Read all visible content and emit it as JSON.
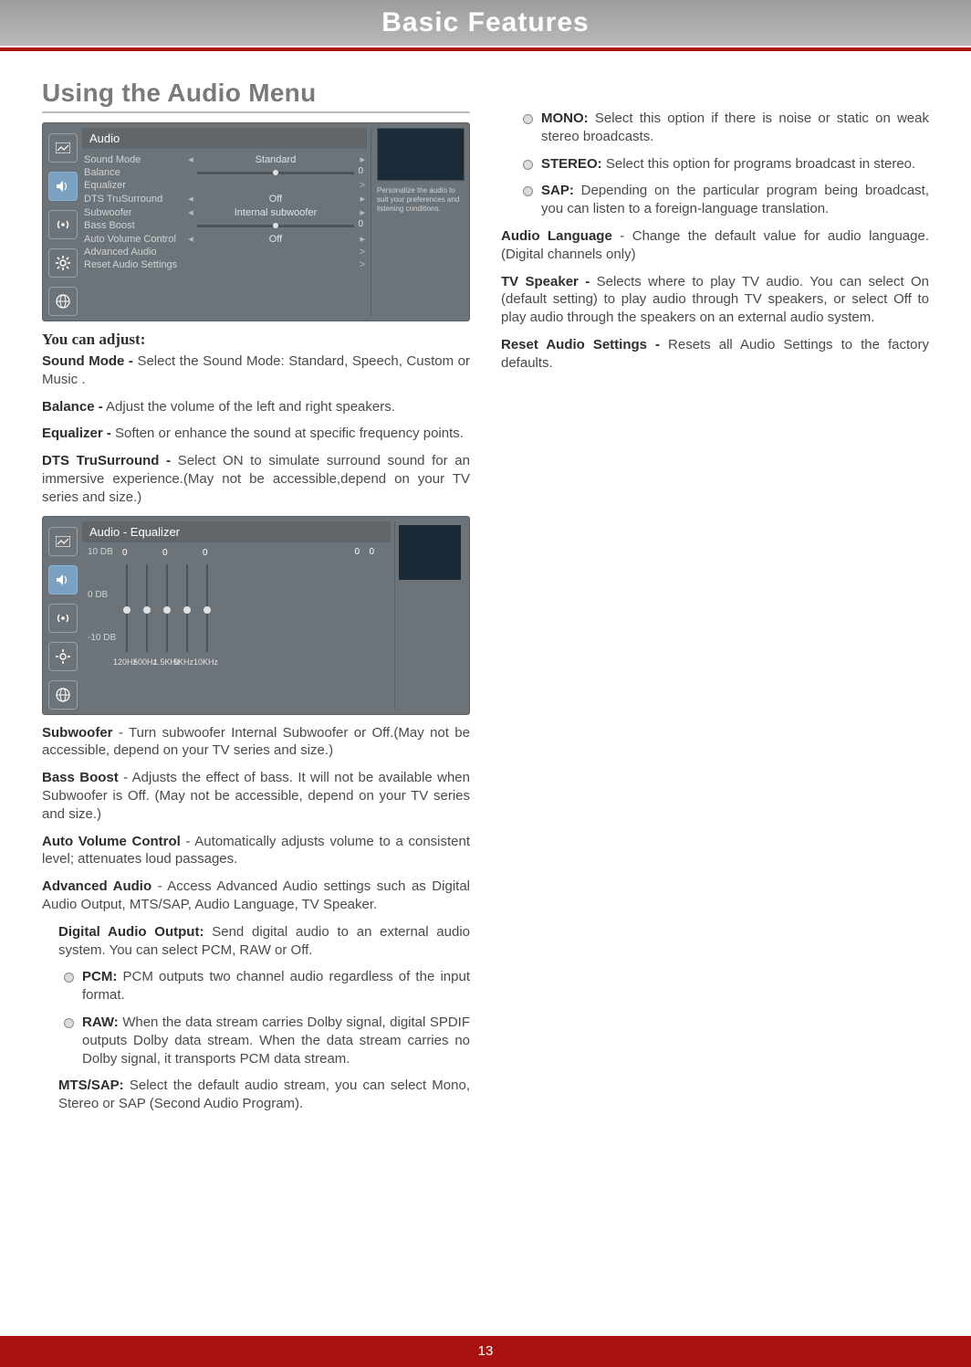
{
  "header": {
    "title": "Basic Features"
  },
  "page_number": "13",
  "section_title": "Using the Audio Menu",
  "menu1": {
    "title": "Audio",
    "side_text": "Personalize the audio to suit your preferences and listening conditions.",
    "rows": {
      "sound_mode": {
        "label": "Sound Mode",
        "value": "Standard"
      },
      "balance": {
        "label": "Balance",
        "value_num": "0"
      },
      "equalizer": {
        "label": "Equalizer"
      },
      "dts": {
        "label": "DTS TruSurround",
        "value": "Off"
      },
      "subwoofer": {
        "label": "Subwoofer",
        "value": "Internal subwoofer"
      },
      "bass": {
        "label": "Bass Boost",
        "value_num": "0"
      },
      "avc": {
        "label": "Auto Volume Control",
        "value": "Off"
      },
      "adv": {
        "label": "Advanced Audio"
      },
      "reset": {
        "label": "Reset Audio Settings"
      }
    }
  },
  "h3_adjust": "You can adjust:",
  "para": {
    "sound_mode": "Sound Mode - Select the Sound Mode: Standard, Speech, Custom or Music .",
    "balance": "Balance - Adjust the volume of the left and right speakers.",
    "equalizer": "Equalizer - Soften or enhance the sound at specific frequency points.",
    "dts": "DTS TruSurround - Select ON to simulate surround sound for an immersive experience.(May not be accessible,depend on your TV series and size.)",
    "subwoofer": "Subwoofer - Turn subwoofer Internal Subwoofer or Off.(May not be accessible, depend on your TV series and size.)",
    "bass": "Bass Boost - Adjusts the effect of bass. It will not be available when Subwoofer is Off. (May not be accessible, depend on your TV series and size.)",
    "avc": "Auto Volume Control - Automatically adjusts volume to a consistent level; attenuates loud passages.",
    "adv": "Advanced Audio - Access Advanced Audio settings such as Digital Audio Output, MTS/SAP, Audio Language, TV Speaker.",
    "dao": "Digital Audio Output: Send digital audio to an external audio system. You can select PCM, RAW or Off.",
    "pcm": "PCM: PCM outputs two channel audio regardless of the input format.",
    "raw": "RAW: When the data stream carries Dolby signal, digital SPDIF outputs Dolby data stream. When the data stream carries no Dolby signal, it transports PCM data stream.",
    "mts": "MTS/SAP: Select the default audio stream, you can select Mono, Stereo or SAP (Second Audio Program).",
    "mono": "MONO: Select this option if there is noise or static on weak stereo broadcasts.",
    "stereo": "STEREO: Select this option for programs broadcast in stereo.",
    "sap": "SAP: Depending on the particular program being broadcast, you can listen to a foreign-language translation.",
    "audiolang": "Audio Language - Change the default value for audio language. (Digital channels only)",
    "tvspeaker": "TV Speaker - Selects where to play TV audio. You can select On (default setting) to play audio through TV speakers, or select Off to play audio through the speakers on an external audio system.",
    "reset": "Reset Audio Settings - Resets all Audio Settings to the factory defaults."
  },
  "eq": {
    "title": "Audio - Equalizer",
    "y": {
      "hi": "10 DB",
      "mid": "0 DB",
      "lo": "-10 DB"
    },
    "bars": [
      {
        "top": "0",
        "freq": "120Hz"
      },
      {
        "top": "",
        "freq": "500Hz"
      },
      {
        "top": "0",
        "freq": "1.5KHz"
      },
      {
        "top": "",
        "freq": "5KHz"
      },
      {
        "top": "0",
        "freq": "10KHz"
      }
    ],
    "extra_top": {
      "a": "0",
      "b": "0"
    }
  },
  "chart_data": {
    "type": "bar",
    "title": "Audio - Equalizer",
    "categories": [
      "120Hz",
      "500Hz",
      "1.5KHz",
      "5KHz",
      "10KHz"
    ],
    "values": [
      0,
      0,
      0,
      0,
      0
    ],
    "ylabel": "DB",
    "ylim": [
      -10,
      10
    ]
  }
}
